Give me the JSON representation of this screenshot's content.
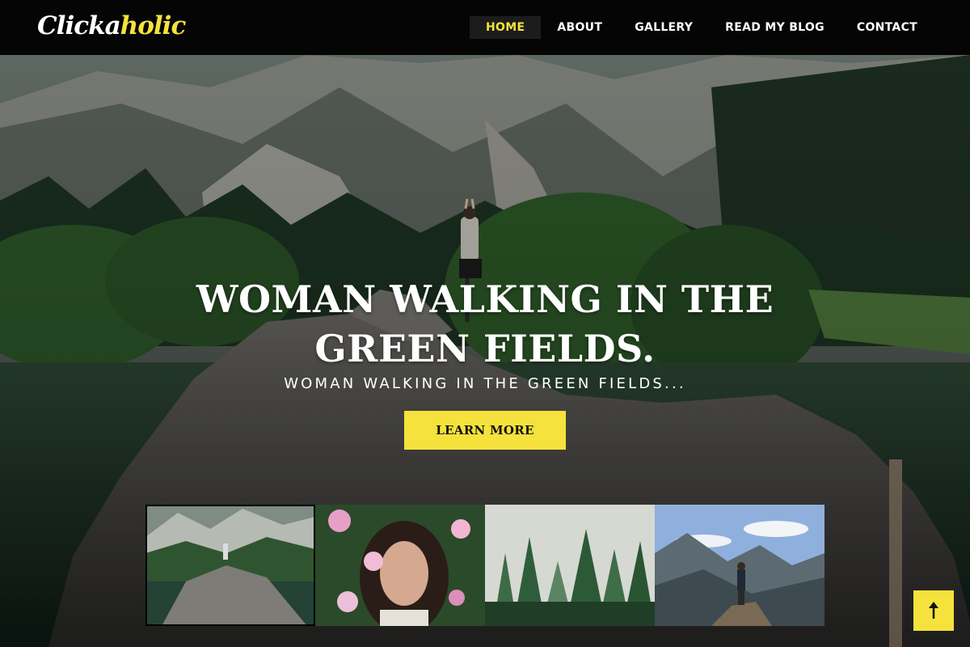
{
  "brand": {
    "logo_part1": "Clicka",
    "logo_part2": "holic",
    "accent_color": "#f5e23c"
  },
  "nav": {
    "items": [
      {
        "label": "HOME",
        "active": true
      },
      {
        "label": "ABOUT",
        "active": false
      },
      {
        "label": "GALLERY",
        "active": false
      },
      {
        "label": "READ MY BLOG",
        "active": false
      },
      {
        "label": "CONTACT",
        "active": false
      }
    ]
  },
  "hero": {
    "title": "WOMAN WALKING IN THE GREEN FIELDS.",
    "subtitle": "WOMAN WALKING IN THE GREEN FIELDS...",
    "button_label": "LEARN MORE"
  },
  "gallery": {
    "thumbnails": [
      {
        "subject": "mountain-lake-rock",
        "active": true
      },
      {
        "subject": "woman-with-flowers",
        "active": false
      },
      {
        "subject": "misty-pine-forest",
        "active": false
      },
      {
        "subject": "hiker-on-mountain-peak",
        "active": false
      }
    ]
  },
  "back_to_top": {
    "icon": "arrow-up-icon"
  }
}
